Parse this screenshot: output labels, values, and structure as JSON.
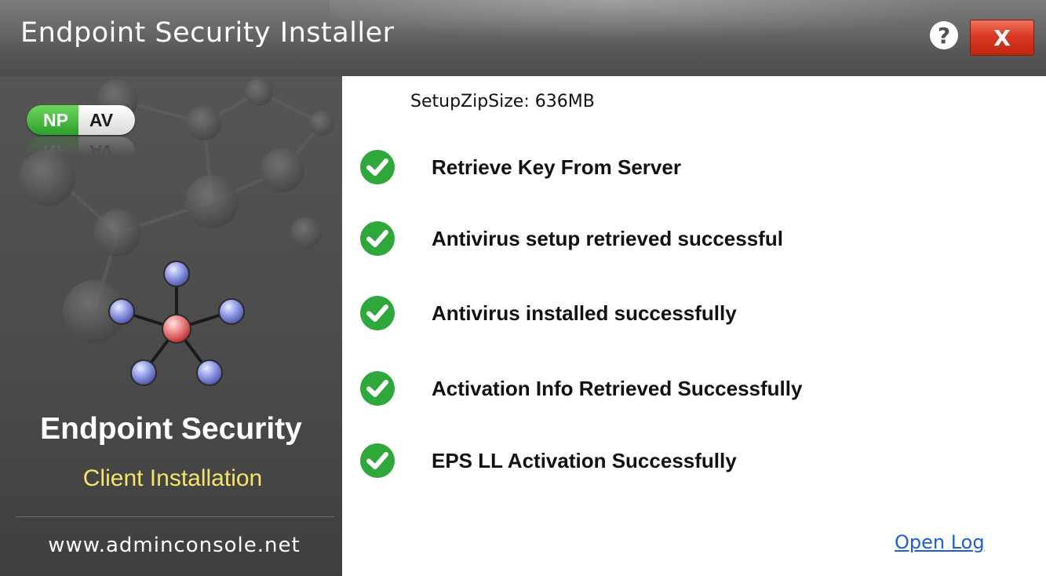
{
  "window": {
    "title": "Endpoint Security Installer",
    "help_label": "?",
    "close_label": "X"
  },
  "sidebar": {
    "badge": {
      "left": "NP",
      "right": "AV"
    },
    "title": "Endpoint Security",
    "subtitle": "Client Installation",
    "url": "www.adminconsole.net"
  },
  "content": {
    "setup_zip_size": "SetupZipSize: 636MB",
    "steps": [
      {
        "label": "Retrieve Key From Server",
        "status": "success"
      },
      {
        "label": "Antivirus setup retrieved successful",
        "status": "success"
      },
      {
        "label": "Antivirus installed successfully",
        "status": "success"
      },
      {
        "label": "Activation Info Retrieved Successfully",
        "status": "success"
      },
      {
        "label": "EPS LL Activation Successfully",
        "status": "success"
      }
    ],
    "open_log_label": "Open Log"
  },
  "colors": {
    "success_green": "#2ea83a",
    "link_blue": "#1f5fd6",
    "subtitle_yellow": "#f5e36a",
    "close_red": "#d93a24"
  },
  "icons": {
    "step_status": "check-circle-icon",
    "help": "question-icon",
    "close": "close-icon"
  }
}
